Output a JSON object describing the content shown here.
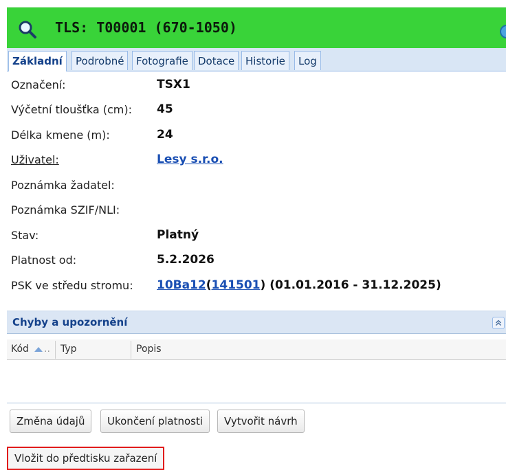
{
  "header": {
    "title": "TLS: T00001 (670-1050)",
    "bg_color": "#39d339",
    "search_icon": "magnifier-icon",
    "refresh_icon": "refresh-icon"
  },
  "tabs": [
    {
      "label": "Základní",
      "active": true
    },
    {
      "label": "Podrobné",
      "active": false
    },
    {
      "label": "Fotografie",
      "active": false
    },
    {
      "label": "Dotace",
      "active": false
    },
    {
      "label": "Historie",
      "active": false
    },
    {
      "label": "Log",
      "active": false
    }
  ],
  "fields": {
    "oznaceni": {
      "label": "Označení:",
      "value": "TSX1"
    },
    "vycetni": {
      "label": "Výčetní tloušťka (cm):",
      "value": "45"
    },
    "delka": {
      "label": "Délka kmene (m):",
      "value": "24"
    },
    "uzivatel": {
      "label": "Uživatel:",
      "value": "Lesy s.r.o."
    },
    "pozn_zadatel": {
      "label": "Poznámka žadatel:",
      "value": ""
    },
    "pozn_szif": {
      "label": "Poznámka SZIF/NLI:",
      "value": ""
    },
    "stav": {
      "label": "Stav:",
      "value": "Platný"
    },
    "platnost": {
      "label": "Platnost od:",
      "value": "5.2.2026"
    },
    "psk": {
      "label": "PSK ve středu stromu:",
      "link1": "10Ba12",
      "open_paren": "(",
      "link2": "141501",
      "rest": ") (01.01.2016 - 31.12.2025)"
    }
  },
  "errors_section": {
    "title": "Chyby a upozornění",
    "columns": {
      "kod": "Kód",
      "typ": "Typ",
      "popis": "Popis"
    }
  },
  "buttons": {
    "zmena": "Změna údajů",
    "ukonceni": "Ukončení platnosti",
    "vytvorit": "Vytvořit návrh",
    "vlozit": "Vložit do předtisku zařazení"
  }
}
